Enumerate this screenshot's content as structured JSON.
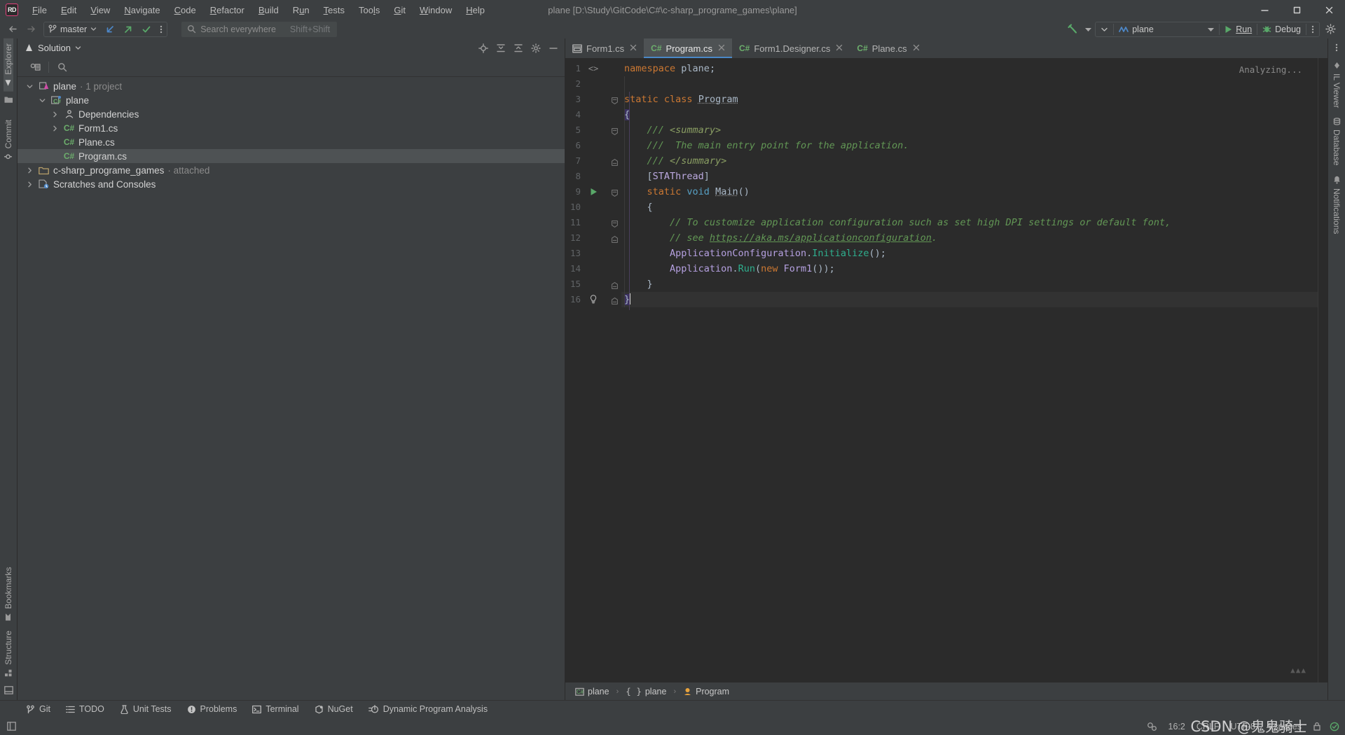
{
  "window": {
    "title": "plane [D:\\Study\\GitCode\\C#\\c-sharp_programe_games\\plane]",
    "logo": "RD"
  },
  "menu": {
    "items": [
      {
        "label": "File"
      },
      {
        "label": "Edit"
      },
      {
        "label": "View"
      },
      {
        "label": "Navigate"
      },
      {
        "label": "Code"
      },
      {
        "label": "Refactor"
      },
      {
        "label": "Build"
      },
      {
        "label": "Run"
      },
      {
        "label": "Tests"
      },
      {
        "label": "Tools"
      },
      {
        "label": "Git"
      },
      {
        "label": "Window"
      },
      {
        "label": "Help"
      }
    ]
  },
  "toolbar": {
    "branch": "master",
    "search_placeholder": "Search everywhere",
    "search_shortcut": "Shift+Shift",
    "run_config": "plane",
    "run_label": "Run",
    "debug_label": "Debug"
  },
  "left_stripe": {
    "top": [
      "Explorer"
    ],
    "mid": [
      "Commit"
    ],
    "bottom": [
      "Bookmarks",
      "Structure"
    ]
  },
  "right_stripe": {
    "items": [
      "IL Viewer",
      "Database",
      "Notifications"
    ]
  },
  "solution": {
    "title": "Solution",
    "tree": [
      {
        "depth": 0,
        "chevron": "down",
        "icon": "solution-icon",
        "label": "plane",
        "suffix": " · 1 project",
        "selected": false
      },
      {
        "depth": 1,
        "chevron": "down",
        "icon": "csharp-project-icon",
        "label": "plane",
        "suffix": "",
        "selected": false
      },
      {
        "depth": 2,
        "chevron": "right",
        "icon": "dependencies-icon",
        "label": "Dependencies",
        "suffix": "",
        "selected": false
      },
      {
        "depth": 2,
        "chevron": "right",
        "icon": "cs-file-icon",
        "label": "Form1.cs",
        "suffix": "",
        "selected": false
      },
      {
        "depth": 2,
        "chevron": "none",
        "icon": "cs-file-icon",
        "label": "Plane.cs",
        "suffix": "",
        "selected": false
      },
      {
        "depth": 2,
        "chevron": "none",
        "icon": "cs-file-icon",
        "label": "Program.cs",
        "suffix": "",
        "selected": true
      },
      {
        "depth": 0,
        "chevron": "right",
        "icon": "folder-icon",
        "label": "c-sharp_programe_games",
        "suffix": " · attached",
        "selected": false
      },
      {
        "depth": 0,
        "chevron": "right",
        "icon": "scratches-icon",
        "label": "Scratches and Consoles",
        "suffix": "",
        "selected": false
      }
    ]
  },
  "editor": {
    "tabs": [
      {
        "label": "Form1.cs",
        "icon": "form-designer-icon",
        "active": false
      },
      {
        "label": "Program.cs",
        "icon": "cs-file-icon",
        "active": true
      },
      {
        "label": "Form1.Designer.cs",
        "icon": "cs-file-icon",
        "active": false
      },
      {
        "label": "Plane.cs",
        "icon": "cs-file-icon",
        "active": false
      }
    ],
    "status_hint": "Analyzing...",
    "line_numbers": [
      "1",
      "2",
      "3",
      "4",
      "5",
      "6",
      "7",
      "8",
      "9",
      "10",
      "11",
      "12",
      "13",
      "14",
      "15",
      "16"
    ],
    "code_lines": [
      "namespace plane;",
      "",
      "static class Program",
      "{",
      "    /// <summary>",
      "    ///  The main entry point for the application.",
      "    /// </summary>",
      "    [STAThread]",
      "    static void Main()",
      "    {",
      "        // To customize application configuration such as set high DPI settings or default font,",
      "        // see https://aka.ms/applicationconfiguration.",
      "        ApplicationConfiguration.Initialize();",
      "        Application.Run(new Form1());",
      "    }",
      "}"
    ],
    "run_gutter_line": 9,
    "bulb_gutter_line": 16,
    "caret_line": 16
  },
  "breadcrumb": {
    "items": [
      {
        "label": "plane",
        "icon": "csharp-project-icon"
      },
      {
        "label": "plane",
        "icon": "namespace-icon"
      },
      {
        "label": "Program",
        "icon": "class-icon"
      }
    ]
  },
  "bottom_tools": [
    {
      "label": "Git",
      "icon": "git-branch-icon"
    },
    {
      "label": "TODO",
      "icon": "todo-icon"
    },
    {
      "label": "Unit Tests",
      "icon": "unit-tests-icon"
    },
    {
      "label": "Problems",
      "icon": "problems-icon"
    },
    {
      "label": "Terminal",
      "icon": "terminal-icon"
    },
    {
      "label": "NuGet",
      "icon": "nuget-icon"
    },
    {
      "label": "Dynamic Program Analysis",
      "icon": "dpa-icon"
    }
  ],
  "statusbar": {
    "caret_position": "16:2",
    "line_separator": "CRLF",
    "encoding": "UTF-8",
    "indent": "4 spaces",
    "watermark_brand": "CSDN",
    "watermark_user": "@鬼鬼骑士"
  },
  "colors": {
    "accent": "#4a88c7",
    "selection": "#4e5254",
    "editor_bg": "#2b2b2b",
    "chrome_bg": "#3c3f41",
    "comment_green": "#629755",
    "keyword_orange": "#cc7832",
    "run_green": "#59a869"
  }
}
